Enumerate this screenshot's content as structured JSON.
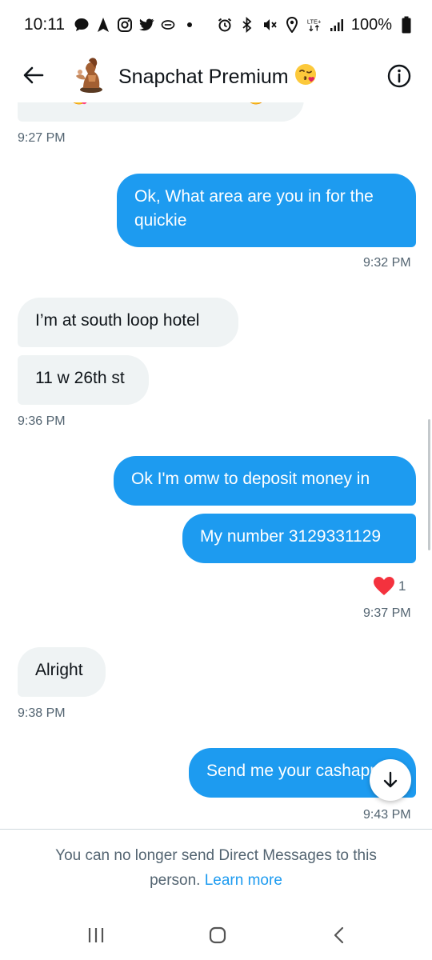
{
  "status_bar": {
    "time": "10:11",
    "battery": "100%",
    "left_icons": [
      "chat-bubble-icon",
      "navigation-icon",
      "instagram-icon",
      "twitter-icon",
      "link-icon"
    ],
    "right_icons": [
      "alarm-icon",
      "bluetooth-icon",
      "mute-icon",
      "location-icon",
      "lte-icon",
      "signal-icon",
      "battery-icon"
    ]
  },
  "header": {
    "title": "Snapchat Premium",
    "title_emoji": "kissing-face-emoji",
    "back_icon": "back-arrow-icon",
    "info_icon": "info-icon"
  },
  "conversation": {
    "partial_text": "free 😋 Lets have some fun 😘",
    "t1": "9:27 PM",
    "m1": "Ok, What area are you in for the",
    "m1b": "quickie",
    "t2": "9:32 PM",
    "m2": "I’m at south loop hotel",
    "m3": "11 w 26th st",
    "t3": "9:36 PM",
    "m4": "Ok I'm omw to deposit money in",
    "m5": "My number 3129331129",
    "reaction_count": "1",
    "reaction_icon": "heart-icon",
    "t4": "9:37 PM",
    "m6": "Alright",
    "t5": "9:38 PM",
    "m7": "Send me your cashapp",
    "t6": "9:43 PM"
  },
  "footer": {
    "notice": "You can no longer send Direct Messages to this person.",
    "learn_more": "Learn more"
  },
  "colors": {
    "accent": "#1d9bf0",
    "incoming_bubble": "#eff3f4",
    "secondary_text": "#536471",
    "heart": "#f91880"
  },
  "navbar": {
    "icons": [
      "recent-apps-icon",
      "home-icon",
      "nav-back-icon"
    ]
  }
}
